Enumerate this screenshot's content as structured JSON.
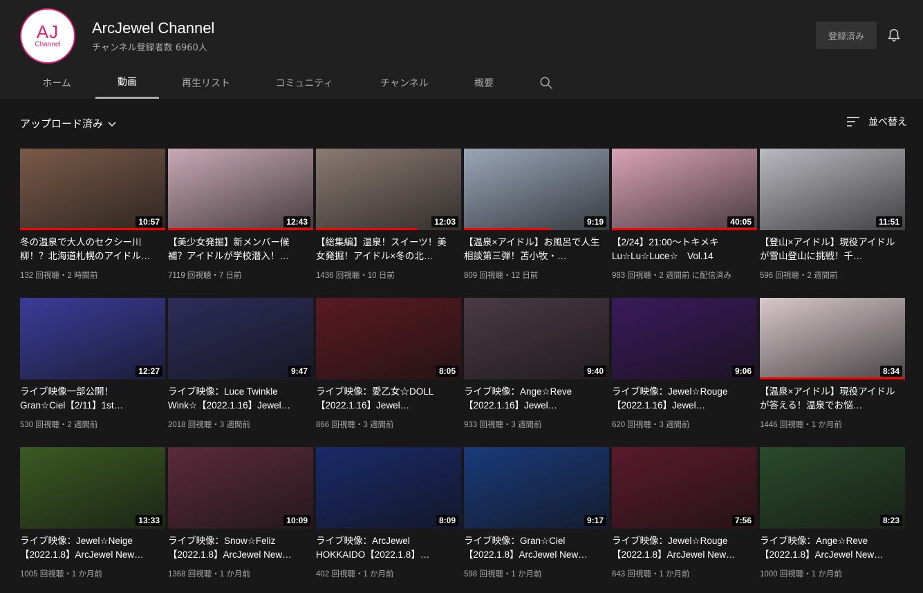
{
  "channel": {
    "avatar_text": "AJ",
    "avatar_sub": "Channel",
    "name": "ArcJewel Channel",
    "subscribers": "チャンネル登録者数 6960人",
    "subscribe_label": "登録済み"
  },
  "tabs": [
    "ホーム",
    "動画",
    "再生リスト",
    "コミュニティ",
    "チャンネル",
    "概要"
  ],
  "active_tab": "動画",
  "filter_label": "アップロード済み",
  "sort_label": "並べ替え",
  "videos": [
    {
      "title": "冬の温泉で大人のセクシー川柳！？北海道札幌のアイドルが…",
      "duration": "10:57",
      "meta": "132 回視聴・2 時間前",
      "color": "#7a5a48"
    },
    {
      "title": "【美少女発掘】新メンバー候補？アイドルが学校潜入！…",
      "duration": "12:43",
      "meta": "7119 回視聴・7 日前",
      "color": "#c9a9b5"
    },
    {
      "title": "【総集編】温泉！スイーツ！美女発掘！アイドル×冬の北…",
      "duration": "12:03",
      "meta": "1436 回視聴・10 日前",
      "color": "#8a7a72"
    },
    {
      "title": "【温泉×アイドル】お風呂で人生相談第三弾！苫小牧・…",
      "duration": "9:19",
      "meta": "809 回視聴・12 日前",
      "color": "#9aa6b8"
    },
    {
      "title": "【2/24】21:00～トキメキLu☆Lu☆Luce☆　Vol.14",
      "duration": "40:05",
      "meta": "983 回視聴・2 週間前 に配信済み",
      "color": "#d9a3b6"
    },
    {
      "title": "【登山×アイドル】現役アイドルが雪山登山に挑戦！千…",
      "duration": "11:51",
      "meta": "596 回視聴・2 週間前",
      "color": "#b9b9c0"
    },
    {
      "title": "ライブ映像一部公開！Gran☆Ciel【2/11】1st…",
      "duration": "12:27",
      "meta": "530 回視聴・2 週間前",
      "color": "#3a3c9a"
    },
    {
      "title": "ライブ映像：Luce Twinkle Wink☆【2022.1.16】Jewel…",
      "duration": "9:47",
      "meta": "2018 回視聴・3 週間前",
      "color": "#2c2c5a"
    },
    {
      "title": "ライブ映像：愛乙女☆DOLL【2022.1.16】Jewel…",
      "duration": "8:05",
      "meta": "866 回視聴・3 週間前",
      "color": "#5a1a22"
    },
    {
      "title": "ライブ映像：Ange☆Reve【2022.1.16】Jewel…",
      "duration": "9:40",
      "meta": "933 回視聴・3 週間前",
      "color": "#4a3a44"
    },
    {
      "title": "ライブ映像：Jewel☆Rouge【2022.1.16】Jewel…",
      "duration": "9:06",
      "meta": "620 回視聴・3 週間前",
      "color": "#3a1a5a"
    },
    {
      "title": "【温泉×アイドル】現役アイドルが答える！温泉でお悩…",
      "duration": "8:34",
      "meta": "1446 回視聴・1 か月前",
      "color": "#d8c8cc"
    },
    {
      "title": "ライブ映像：Jewel☆Neige【2022.1.8】ArcJewel New…",
      "duration": "13:33",
      "meta": "1005 回視聴・1 か月前",
      "color": "#3a5a22"
    },
    {
      "title": "ライブ映像：Snow☆Feliz【2022.1.8】ArcJewel New…",
      "duration": "10:09",
      "meta": "1368 回視聴・1 か月前",
      "color": "#5a2a3a"
    },
    {
      "title": "ライブ映像：ArcJewel HOKKAIDO【2022.1.8】…",
      "duration": "8:09",
      "meta": "402 回視聴・1 か月前",
      "color": "#1a2a6a"
    },
    {
      "title": "ライブ映像：Gran☆Ciel【2022.1.8】ArcJewel New…",
      "duration": "9:17",
      "meta": "598 回視聴・1 か月前",
      "color": "#1a3a7a"
    },
    {
      "title": "ライブ映像：Jewel☆Rouge【2022.1.8】ArcJewel New…",
      "duration": "7:56",
      "meta": "643 回視聴・1 か月前",
      "color": "#5a1a2a"
    },
    {
      "title": "ライブ映像：Ange☆Reve【2022.1.8】ArcJewel New…",
      "duration": "8:23",
      "meta": "1000 回視聴・1 か月前",
      "color": "#2a4a2a"
    }
  ],
  "watched_progress": [
    1,
    1,
    0.7,
    0.6,
    1,
    0,
    0,
    0,
    0,
    0,
    0,
    1,
    0,
    0,
    0,
    0,
    0,
    0
  ]
}
